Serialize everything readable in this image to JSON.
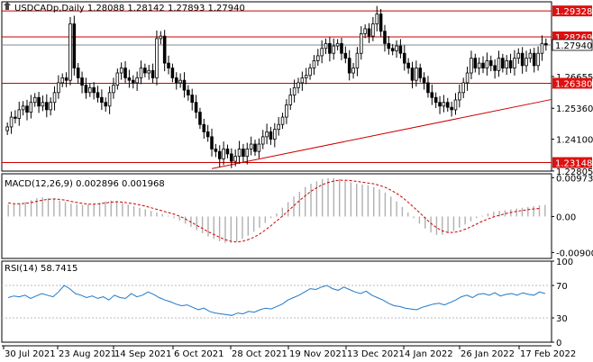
{
  "header": {
    "symbol_line": "USDCADp,Daily  1.28088 1.28142 1.27893 1.27940",
    "macd_label": "MACD(12,26,9) 0.002896 0.001968",
    "rsi_label": "RSI(14) 58.7415"
  },
  "colors": {
    "up_candle": "#000000",
    "down_candle": "#000000",
    "level_line": "#cc0000",
    "level_label_bg": "#dd1111",
    "price_label_bg": "#ffffff",
    "macd_hist": "#b0b0b0",
    "macd_signal": "#cc0000",
    "rsi_line": "#1e78c8",
    "grid_border": "#000000"
  },
  "chart_data": [
    {
      "type": "candlestick",
      "panel": "price",
      "y_ticks": [
        "1.29328",
        "1.28269",
        "1.27940",
        "1.26655",
        "1.26380",
        "1.25360",
        "1.24100",
        "1.23148",
        "1.22805"
      ],
      "ylim": [
        1.228,
        1.297
      ],
      "horizontal_levels": [
        {
          "value": 1.29328,
          "label": "1.29328",
          "style": "red"
        },
        {
          "value": 1.28269,
          "label": "1.28269",
          "style": "red"
        },
        {
          "value": 1.2794,
          "label": "1.27940",
          "style": "current"
        },
        {
          "value": 1.2638,
          "label": "1.26380",
          "style": "red"
        },
        {
          "value": 1.23148,
          "label": "1.23148",
          "style": "red"
        }
      ],
      "trendline": {
        "start": {
          "date": "6 Oct 2021",
          "value": 1.229
        },
        "end": {
          "date": "22 Feb 2022",
          "value": 1.2572
        }
      },
      "closes": [
        1.246,
        1.25,
        1.2495,
        1.253,
        1.2545,
        1.252,
        1.256,
        1.258,
        1.2545,
        1.256,
        1.253,
        1.256,
        1.26,
        1.264,
        1.266,
        1.265,
        1.288,
        1.27,
        1.266,
        1.263,
        1.26,
        1.262,
        1.26,
        1.258,
        1.256,
        1.2545,
        1.26,
        1.263,
        1.268,
        1.27,
        1.266,
        1.265,
        1.264,
        1.266,
        1.27,
        1.268,
        1.269,
        1.266,
        1.282,
        1.283,
        1.272,
        1.27,
        1.266,
        1.264,
        1.265,
        1.261,
        1.259,
        1.256,
        1.252,
        1.247,
        1.244,
        1.242,
        1.237,
        1.236,
        1.233,
        1.237,
        1.235,
        1.232,
        1.234,
        1.237,
        1.234,
        1.237,
        1.239,
        1.236,
        1.239,
        1.242,
        1.244,
        1.241,
        1.245,
        1.247,
        1.25,
        1.255,
        1.259,
        1.262,
        1.264,
        1.266,
        1.267,
        1.27,
        1.273,
        1.275,
        1.278,
        1.28,
        1.276,
        1.279,
        1.28,
        1.276,
        1.274,
        1.268,
        1.27,
        1.276,
        1.284,
        1.286,
        1.283,
        1.288,
        1.292,
        1.285,
        1.28,
        1.278,
        1.277,
        1.279,
        1.276,
        1.272,
        1.27,
        1.265,
        1.27,
        1.266,
        1.264,
        1.26,
        1.258,
        1.256,
        1.2545,
        1.256,
        1.254,
        1.253,
        1.257,
        1.26,
        1.264,
        1.268,
        1.274,
        1.27,
        1.272,
        1.27,
        1.273,
        1.271,
        1.269,
        1.274,
        1.27,
        1.273,
        1.27,
        1.274,
        1.276,
        1.271,
        1.274,
        1.276,
        1.271,
        1.276,
        1.28,
        1.2794
      ],
      "x_ticks": [
        "30 Jul 2021",
        "23 Aug 2021",
        "14 Sep 2021",
        "6 Oct 2021",
        "28 Oct 2021",
        "19 Nov 2021",
        "13 Dec 2021",
        "4 Jan 2022",
        "26 Jan 2022",
        "17 Feb 2022"
      ]
    },
    {
      "type": "bar+line",
      "panel": "macd",
      "series": [
        {
          "kind": "histogram",
          "values": [
            0.003,
            0.0031,
            0.0033,
            0.0036,
            0.0041,
            0.0046,
            0.0048,
            0.0046,
            0.0044,
            0.004,
            0.0036,
            0.0032,
            0.003,
            0.0029,
            0.003,
            0.0032,
            0.0035,
            0.0038,
            0.004,
            0.0038,
            0.0034,
            0.003,
            0.0026,
            0.0022,
            0.0018,
            0.0014,
            0.001,
            0.0006,
            0.0002,
            -0.0004,
            -0.001,
            -0.0018,
            -0.0026,
            -0.0034,
            -0.0042,
            -0.005,
            -0.0056,
            -0.0062,
            -0.0066,
            -0.0066,
            -0.0062,
            -0.0056,
            -0.0048,
            -0.0038,
            -0.0028,
            -0.0016,
            -0.0004,
            0.0008,
            0.0022,
            0.0036,
            0.005,
            0.0062,
            0.0074,
            0.0082,
            0.0088,
            0.0094,
            0.0096,
            0.0096,
            0.0094,
            0.009,
            0.0086,
            0.0082,
            0.008,
            0.0078,
            0.0074,
            0.0068,
            0.006,
            0.005,
            0.0038,
            0.0024,
            0.001,
            -0.0004,
            -0.0018,
            -0.003,
            -0.004,
            -0.0046,
            -0.0046,
            -0.0042,
            -0.0036,
            -0.0028,
            -0.002,
            -0.0012,
            -0.0004,
            0.0002,
            0.0008,
            0.0012,
            0.0014,
            0.0016,
            0.0018,
            0.002,
            0.0022,
            0.0024,
            0.0026,
            0.0028,
            0.0029
          ]
        },
        {
          "kind": "signal",
          "values": [
            0.0034,
            0.0032,
            0.0032,
            0.0033,
            0.0035,
            0.0038,
            0.0041,
            0.0043,
            0.0044,
            0.0043,
            0.0041,
            0.0038,
            0.0035,
            0.0033,
            0.0031,
            0.0031,
            0.0032,
            0.0034,
            0.0036,
            0.0037,
            0.0036,
            0.0034,
            0.0032,
            0.0029,
            0.0026,
            0.0022,
            0.0018,
            0.0014,
            0.001,
            0.0006,
            0.0001,
            -0.0006,
            -0.0014,
            -0.0022,
            -0.003,
            -0.0038,
            -0.0045,
            -0.0052,
            -0.0058,
            -0.0062,
            -0.0064,
            -0.0062,
            -0.0058,
            -0.0052,
            -0.0044,
            -0.0034,
            -0.0023,
            -0.0011,
            0.0001,
            0.0014,
            0.0027,
            0.004,
            0.0052,
            0.0063,
            0.0072,
            0.008,
            0.0085,
            0.0089,
            0.0091,
            0.0091,
            0.009,
            0.0088,
            0.0086,
            0.0084,
            0.0082,
            0.0078,
            0.0073,
            0.0066,
            0.0058,
            0.0048,
            0.0036,
            0.0023,
            0.001,
            -0.0004,
            -0.0017,
            -0.0028,
            -0.0036,
            -0.004,
            -0.004,
            -0.0037,
            -0.0032,
            -0.0026,
            -0.0019,
            -0.0012,
            -0.0006,
            -0.0001,
            0.0003,
            0.0007,
            0.001,
            0.0013,
            0.0015,
            0.0017,
            0.0019,
            0.002
          ]
        }
      ],
      "y_ticks": [
        "0.009732",
        "0.00",
        "-0.009007"
      ],
      "ylim": [
        -0.0105,
        0.0107
      ]
    },
    {
      "type": "line",
      "panel": "rsi",
      "series": [
        {
          "values": [
            55,
            57,
            56,
            58,
            54,
            57,
            60,
            58,
            56,
            62,
            70,
            66,
            60,
            58,
            55,
            57,
            54,
            56,
            52,
            58,
            55,
            54,
            60,
            56,
            58,
            62,
            59,
            55,
            52,
            50,
            47,
            45,
            46,
            43,
            40,
            42,
            38,
            36,
            35,
            34,
            33,
            36,
            35,
            38,
            37,
            40,
            42,
            41,
            44,
            47,
            52,
            55,
            58,
            62,
            66,
            65,
            68,
            70,
            66,
            64,
            68,
            65,
            62,
            60,
            63,
            58,
            55,
            52,
            48,
            45,
            44,
            42,
            41,
            40,
            43,
            45,
            47,
            48,
            46,
            49,
            52,
            56,
            58,
            55,
            59,
            60,
            58,
            61,
            57,
            59,
            60,
            58,
            61,
            59,
            58,
            62,
            60
          ]
        }
      ],
      "y_ticks": [
        "100",
        "70",
        "30",
        "0"
      ],
      "ylim": [
        0,
        100
      ]
    }
  ]
}
